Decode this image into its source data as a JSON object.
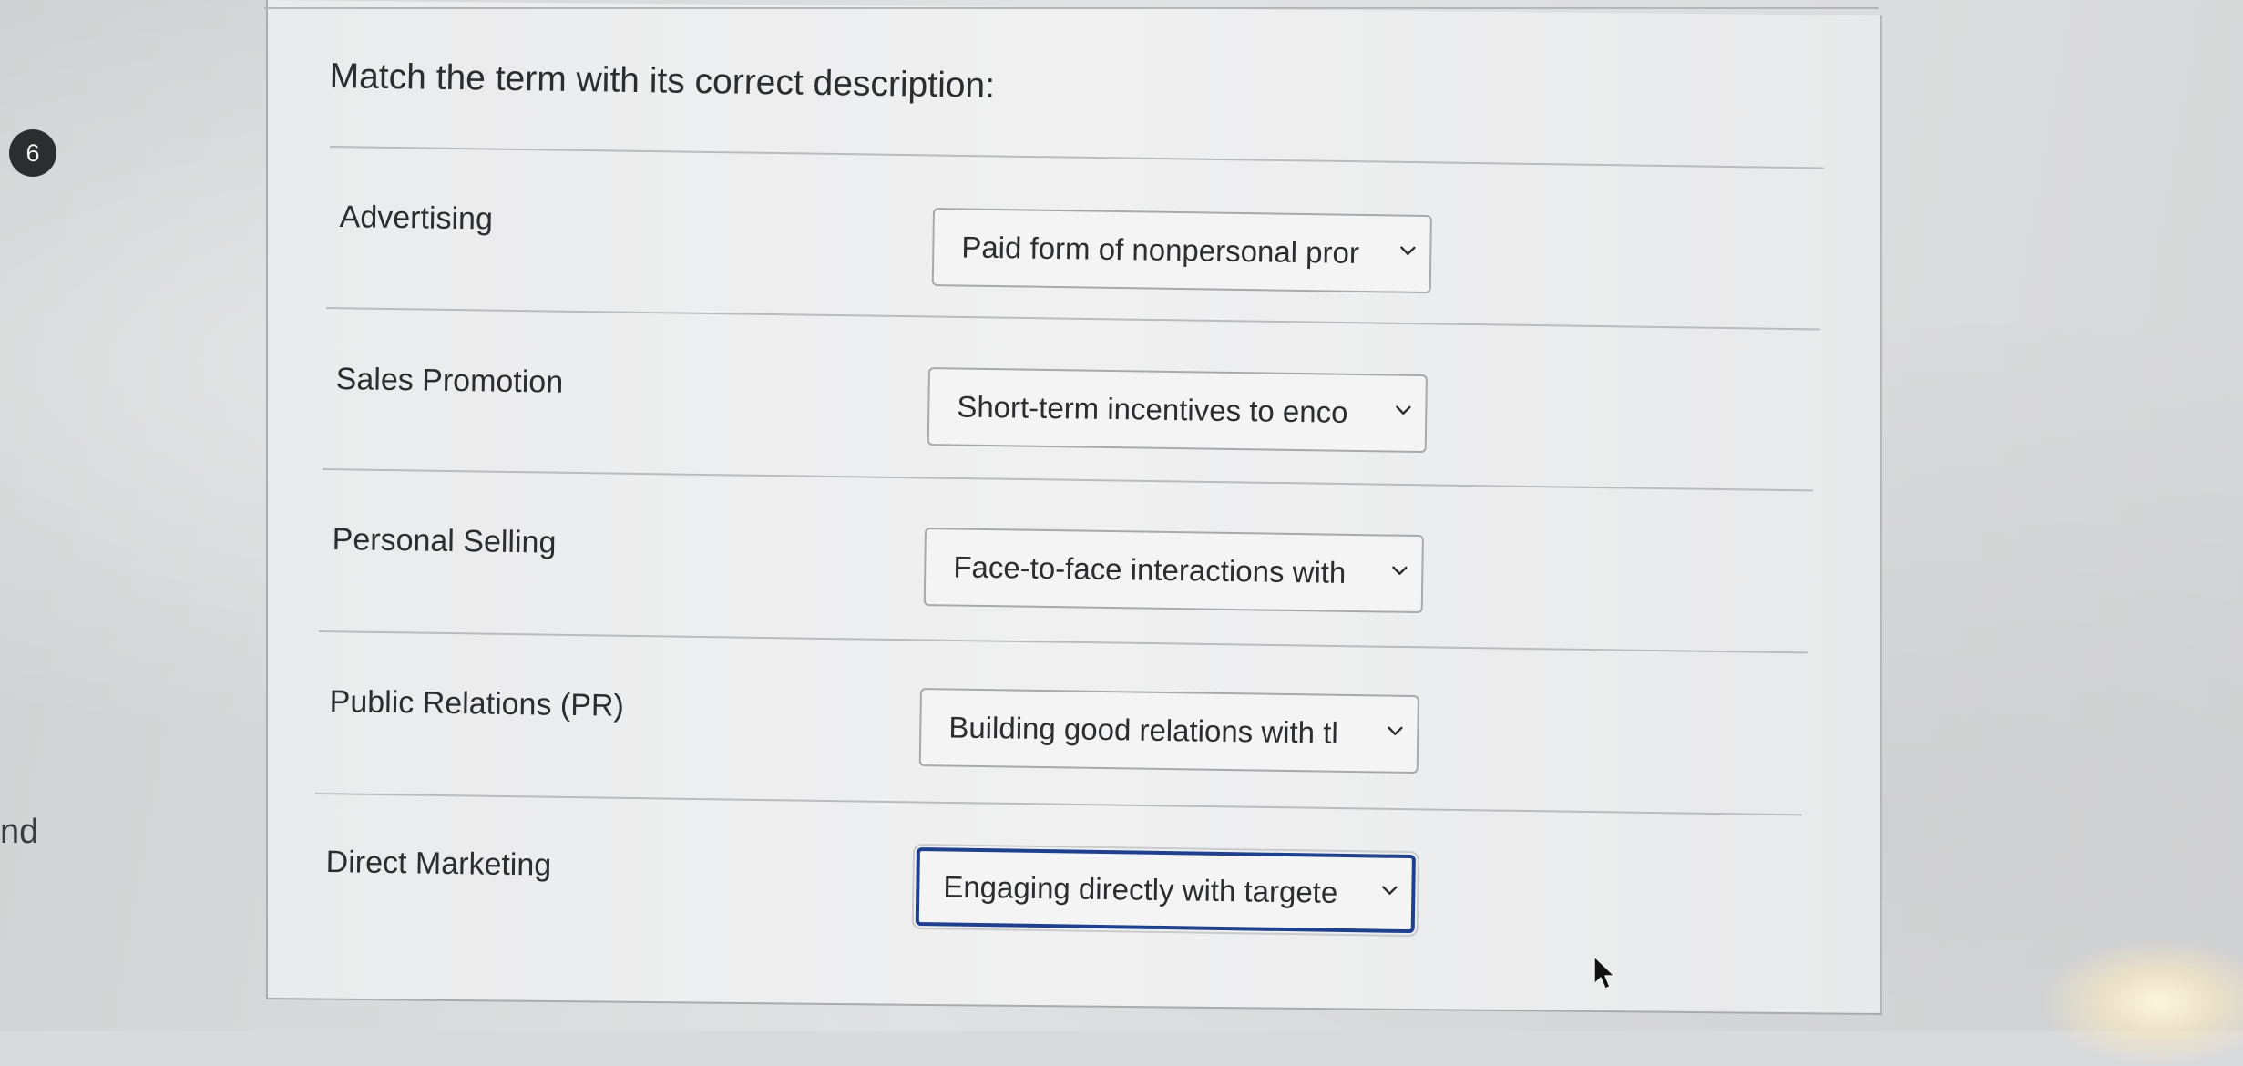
{
  "question": {
    "number": "6",
    "prompt": "Match the term with its correct description:"
  },
  "left_fragment": "nd",
  "items": [
    {
      "term": "Advertising",
      "selected": "Paid form of nonpersonal pror"
    },
    {
      "term": "Sales Promotion",
      "selected": "Short-term incentives to enco"
    },
    {
      "term": "Personal Selling",
      "selected": "Face-to-face interactions with"
    },
    {
      "term": "Public Relations (PR)",
      "selected": "Building good relations with tl"
    },
    {
      "term": "Direct Marketing",
      "selected": "Engaging directly with targete"
    }
  ],
  "icons": {
    "dropdown": "chevron-down-icon",
    "pointer": "mouse-pointer-icon"
  },
  "colors": {
    "focus_border": "#1f3f8f",
    "text": "#2c2d2f",
    "badge": "#2b2d2f"
  }
}
